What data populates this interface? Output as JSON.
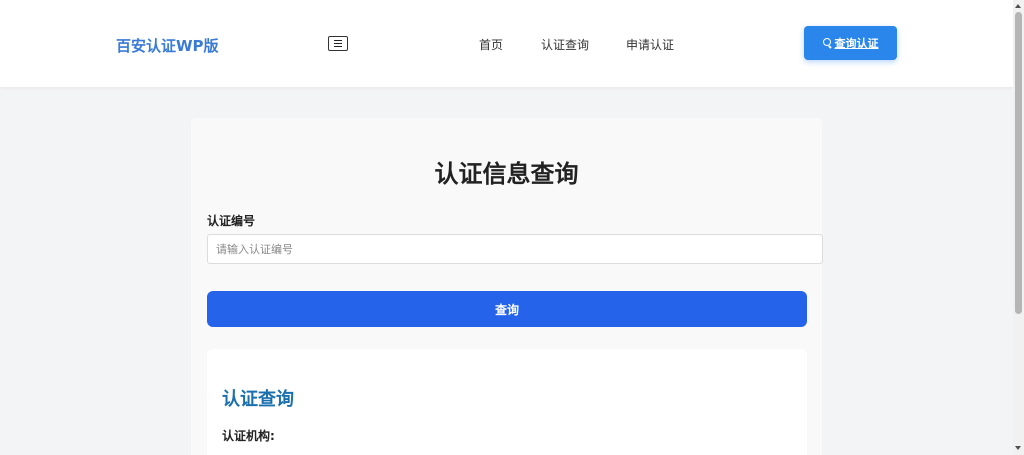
{
  "header": {
    "brand": "百安认证WP版",
    "nav": {
      "home": "首页",
      "query": "认证查询",
      "apply": "申请认证"
    },
    "query_button": "查询认证"
  },
  "form": {
    "title": "认证信息查询",
    "field_label": "认证编号",
    "placeholder": "请输入认证编号",
    "value": "",
    "submit": "查询"
  },
  "result": {
    "title": "认证查询",
    "org_label": "认证机构:"
  },
  "colors": {
    "brand": "#3a7bd5",
    "primary": "#2563eb",
    "top_button": "#2a86ea",
    "result_title": "#1a6fae"
  },
  "icons": {
    "menu": "hamburger-icon",
    "search": "search-icon"
  }
}
